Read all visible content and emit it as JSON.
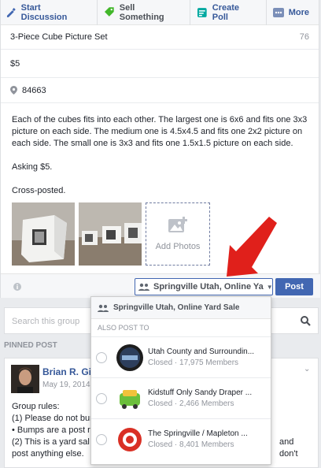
{
  "tabs": [
    {
      "label": "Start Discussion"
    },
    {
      "label": "Sell Something"
    },
    {
      "label": "Create Poll"
    },
    {
      "label": "More"
    }
  ],
  "listing": {
    "title": "3-Piece Cube Picture Set",
    "title_chars_left": "76",
    "price": "$5",
    "location": "84663",
    "desc_p1": "Each of the cubes fits into each other.  The largest one is 6x6 and fits one 3x3 picture on each side.  The medium one is 4.5x4.5 and fits one 2x2 picture on each side.  The small one is 3x3 and fits one 1.5x1.5 picture on each side.",
    "desc_p2": "Asking $5.",
    "desc_p3": "Cross-posted.",
    "add_photos": "Add Photos"
  },
  "footer": {
    "audience": "Springville Utah, Online Ya",
    "post_label": "Post"
  },
  "search": {
    "placeholder": "Search this group"
  },
  "pinned": {
    "header": "PINNED POST",
    "author": "Brian R. Gib",
    "date": "May 19, 2014",
    "rules_title": "Group rules:",
    "rule1": "(1) Please do not bur",
    "rule2": "• Bumps are a post r",
    "rule3": "(2) This is a yard sal",
    "rule3_tail": "and don't",
    "rule4": "post anything else."
  },
  "dropdown": {
    "current_group": "Springville Utah, Online Yard Sale",
    "also_post_to": "ALSO POST TO",
    "groups": [
      {
        "name": "Utah County and Surroundin...",
        "status": "Closed · 17,975 Members"
      },
      {
        "name": "Kidstuff Only Sandy Draper ...",
        "status": "Closed · 2,466 Members"
      },
      {
        "name": "The Springville / Mapleton ...",
        "status": "Closed · 8,401 Members"
      }
    ]
  },
  "colors": {
    "accent": "#4267b2",
    "arrow": "#e0201b"
  }
}
